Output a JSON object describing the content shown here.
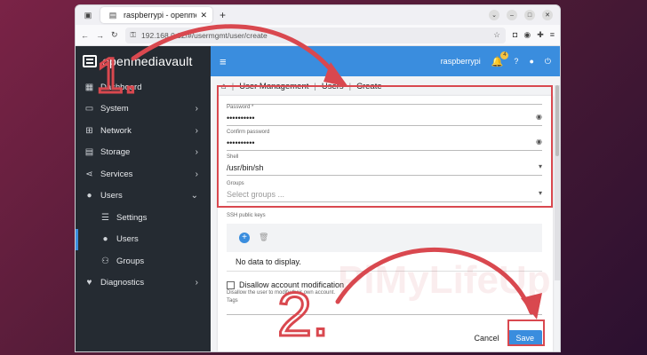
{
  "browser": {
    "tab_title": "raspberrypi - openmedia...",
    "url": "192.168.0.32/#/usermgmt/user/create",
    "new_tab_glyph": "+"
  },
  "app": {
    "brand": "openmediavault",
    "hostname": "raspberrypi",
    "notification_count": "4"
  },
  "sidebar": {
    "items": [
      {
        "label": "Dashboard",
        "icon": "dashboard-icon"
      },
      {
        "label": "System",
        "icon": "laptop-icon"
      },
      {
        "label": "Network",
        "icon": "network-icon"
      },
      {
        "label": "Storage",
        "icon": "storage-icon"
      },
      {
        "label": "Services",
        "icon": "share-icon"
      },
      {
        "label": "Users",
        "icon": "users-icon"
      },
      {
        "label": "Settings",
        "icon": "sliders-icon"
      },
      {
        "label": "Users",
        "icon": "user-icon"
      },
      {
        "label": "Groups",
        "icon": "groups-icon"
      },
      {
        "label": "Diagnostics",
        "icon": "heartbeat-icon"
      }
    ]
  },
  "breadcrumb": {
    "part1": "User Management",
    "part2": "Users",
    "part3": "Create"
  },
  "form": {
    "password": {
      "label": "Password *",
      "value": "••••••••••"
    },
    "confirm": {
      "label": "Confirm password",
      "value": "••••••••••"
    },
    "shell": {
      "label": "Shell",
      "value": "/usr/bin/sh"
    },
    "groups": {
      "label": "Groups",
      "placeholder": "Select groups ..."
    },
    "ssh_label": "SSH public keys",
    "no_data": "No data to display.",
    "disallow_label": "Disallow account modification",
    "disallow_hint": "Disallow the user to modify their own account.",
    "tags_label": "Tags",
    "cancel": "Cancel",
    "save": "Save"
  },
  "annotations": {
    "step1": "1.",
    "step2": "2.",
    "color": "#d9484f"
  },
  "watermark": "PiMyLifeUp"
}
